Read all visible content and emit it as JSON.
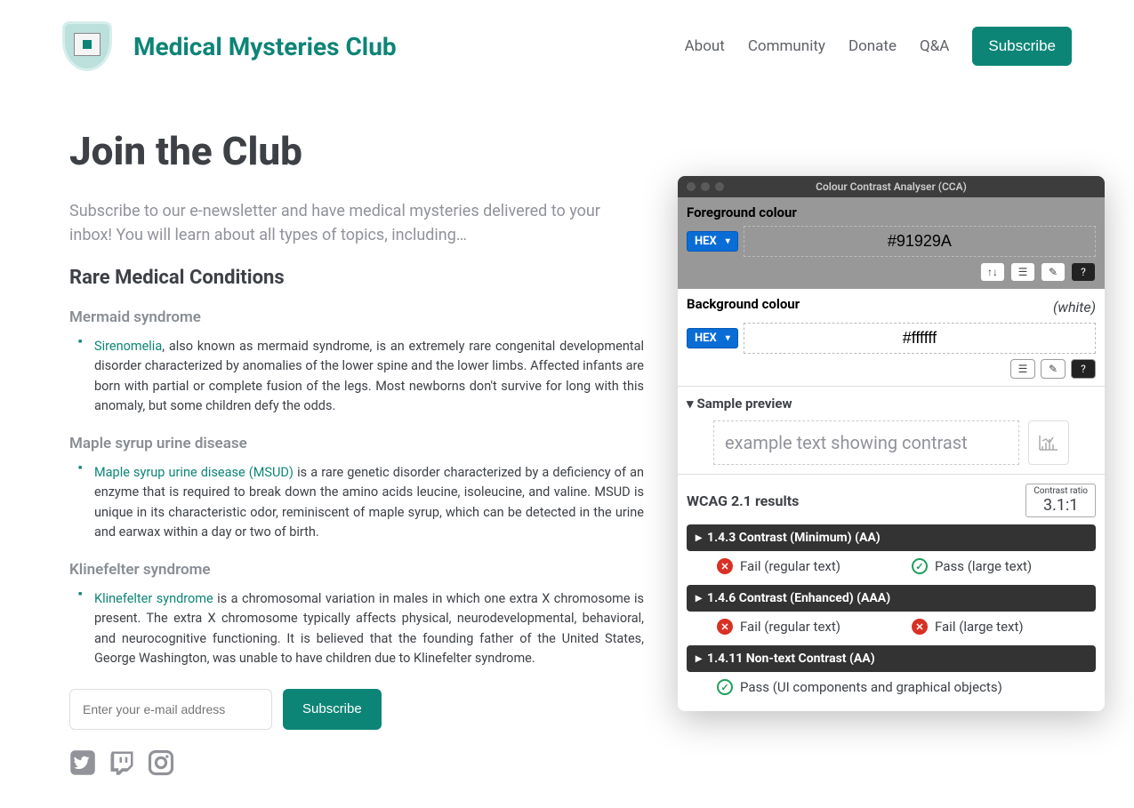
{
  "header": {
    "brand_name": "Medical Mysteries Club",
    "nav": {
      "about": "About",
      "community": "Community",
      "donate": "Donate",
      "qa": "Q&A"
    },
    "subscribe": "Subscribe"
  },
  "main": {
    "title": "Join the Club",
    "intro": "Subscribe to our e-newsletter and have medical mysteries delivered to your inbox! You will learn about all types of topics, including…",
    "section_title": "Rare Medical Conditions",
    "conditions": {
      "mermaid": {
        "name": "Mermaid syndrome",
        "link": "Sirenomelia",
        "text": ", also known as mermaid syndrome, is an extremely rare congenital developmental disorder characterized by anomalies of the lower spine and the lower limbs. Affected infants are born with partial or complete fusion of the legs. Most newborns don't survive for long with this anomaly, but some children defy the odds."
      },
      "msud": {
        "name": "Maple syrup urine disease",
        "link": "Maple syrup urine disease (MSUD)",
        "text": " is a rare genetic disorder characterized by a deficiency of an enzyme that is required to break down the amino acids leucine, isoleucine, and valine. MSUD is unique in its characteristic odor, reminiscent of maple syrup, which can be detected in the urine and earwax within a day or two of birth."
      },
      "klinefelter": {
        "name": "Klinefelter syndrome",
        "link": "Klinefelter syndrome",
        "text": " is a chromosomal variation in males in which one extra X chromosome is present. The extra X chromosome typically affects physical, neurodevelopmental, behavioral, and neurocognitive functioning. It is believed that the founding father of the United States, George Washington, was unable to have children due to Klinefelter syndrome."
      }
    },
    "email_placeholder": "Enter your e-mail address",
    "subscribe_btn": "Subscribe"
  },
  "cca": {
    "title": "Colour Contrast Analyser (CCA)",
    "fg_label": "Foreground colour",
    "bg_label": "Background colour",
    "white_label": "(white)",
    "hex_label": "HEX",
    "fg_value": "#91929A",
    "bg_value": "#ffffff",
    "sample_label": "Sample preview",
    "sample_text": "example text showing contrast",
    "results_title": "WCAG 2.1 results",
    "ratio_label": "Contrast ratio",
    "ratio_value": "3.1:1",
    "criteria": {
      "c143": "1.4.3 Contrast (Minimum) (AA)",
      "c146": "1.4.6 Contrast (Enhanced) (AAA)",
      "c1411": "1.4.11 Non-text Contrast (AA)"
    },
    "results": {
      "fail_regular": "Fail (regular text)",
      "pass_large": "Pass (large text)",
      "fail_large": "Fail (large text)",
      "pass_ui": "Pass (UI components and graphical objects)"
    }
  }
}
